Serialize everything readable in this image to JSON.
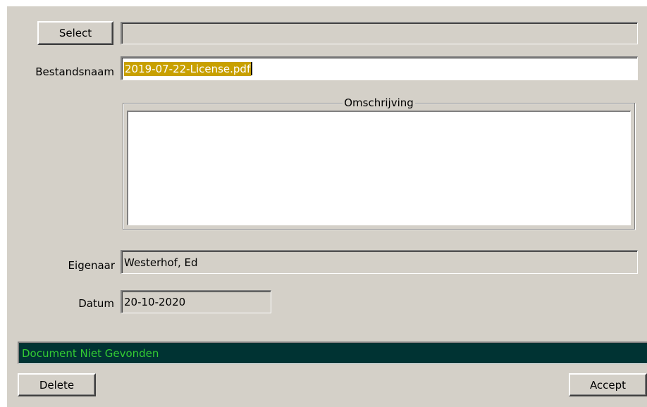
{
  "form": {
    "select_button_label": "Select",
    "selected_path_value": "",
    "filename_label": "Bestandsnaam",
    "filename_value": "2019-07-22-License.pdf",
    "description_group_label": "Omschrijving",
    "description_value": "",
    "owner_label": "Eigenaar",
    "owner_value": "Westerhof, Ed",
    "date_label": "Datum",
    "date_value": "20-10-2020"
  },
  "status": {
    "message": "Document Niet Gevonden",
    "background_color": "#003333",
    "text_color": "#33cc33"
  },
  "footer": {
    "delete_label": "Delete",
    "accept_label": "Accept"
  },
  "colors": {
    "window_background": "#d4d0c8",
    "selection_highlight": "#c8a000"
  }
}
